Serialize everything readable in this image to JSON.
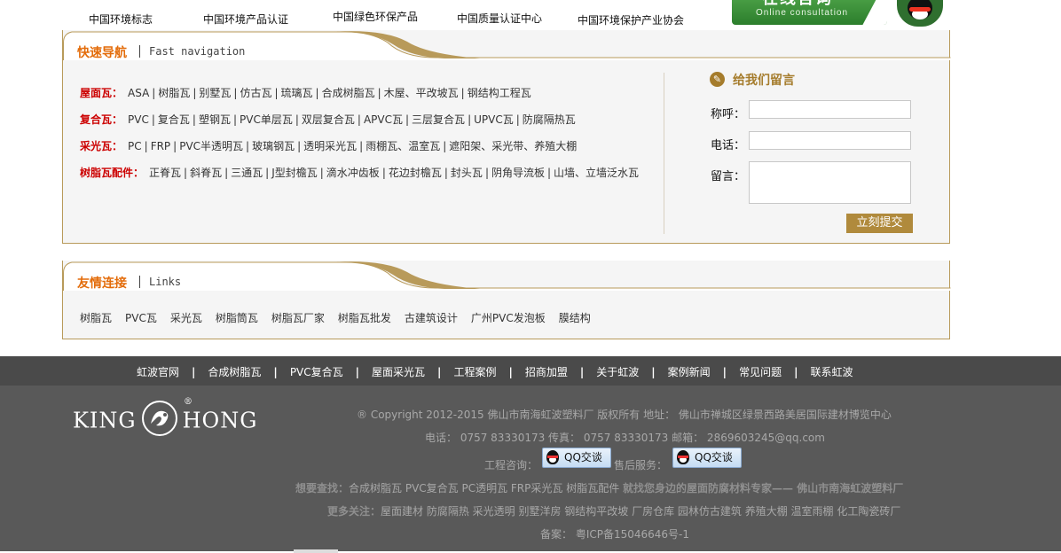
{
  "top_links": [
    "中国环境标志",
    "中国环境产品认证",
    "中国绿色环保产品",
    "中国质量认证中心",
    "中国环境保护产业协会"
  ],
  "online_consult": {
    "title": "在线咨询",
    "subtitle": "Online consultation"
  },
  "quick_nav": {
    "title": "快速导航",
    "title_en": "Fast navigation",
    "rows": [
      {
        "category": "屋面瓦：",
        "items": [
          "ASA",
          "树脂瓦",
          "别墅瓦",
          "仿古瓦",
          "琉璃瓦",
          "合成树脂瓦",
          "木屋、平改坡瓦",
          "钢结构工程瓦"
        ]
      },
      {
        "category": "复合瓦：",
        "items": [
          "PVC",
          "复合瓦",
          "塑钢瓦",
          "PVC单层瓦",
          "双层复合瓦",
          "APVC瓦",
          "三层复合瓦",
          "UPVC瓦",
          "防腐隔热瓦"
        ]
      },
      {
        "category": "采光瓦：",
        "items": [
          "PC",
          "FRP",
          "PVC半透明瓦",
          "玻璃钢瓦",
          "透明采光瓦",
          "雨棚瓦、温室瓦",
          "遮阳架、采光带、养殖大棚"
        ]
      },
      {
        "category": "树脂瓦配件：",
        "items": [
          "正脊瓦",
          "斜脊瓦",
          "三通瓦",
          "J型封檐瓦",
          "滴水冲齿板",
          "花边封檐瓦",
          "封头瓦",
          "阴角导流板",
          "山墙、立墙泛水瓦"
        ]
      }
    ]
  },
  "message": {
    "title": "给我们留言",
    "name_label": "称呼：",
    "phone_label": "电话：",
    "msg_label": "留言：",
    "name_value": "",
    "phone_value": "",
    "msg_value": "",
    "submit_label": "立刻提交"
  },
  "links": {
    "title": "友情连接",
    "title_en": "Links",
    "items": [
      "树脂瓦",
      "PVC瓦",
      "采光瓦",
      "树脂筒瓦",
      "树脂瓦厂家",
      "树脂瓦批发",
      "古建筑设计",
      "广州PVC发泡板",
      "膜结构"
    ]
  },
  "footer": {
    "nav": [
      "虹波官网",
      "合成树脂瓦",
      "PVC复合瓦",
      "屋面采光瓦",
      "工程案例",
      "招商加盟",
      "关于虹波",
      "案例新闻",
      "常见问题",
      "联系虹波"
    ],
    "logo_left": "KING",
    "logo_right": "HONG",
    "logo_reg": "®",
    "copyright": "® Copyright 2012-2015 佛山市南海虹波塑料厂 版权所有 地址：  佛山市禅城区绿景西路美居国际建材博览中心",
    "contact": "电话：  0757 83330173 传真：  0757 83330173 邮箱：   2869603245@qq.com",
    "consult_label": "工程咨询：",
    "aftersale_label": "售后服务：",
    "qq_label": "QQ交谈",
    "search_label": "想要查找：",
    "search_text": "合成树脂瓦 PVC复合瓦 PC透明瓦 FRP采光瓦 树脂瓦配件",
    "search_slogan": "就找您身边的屋面防腐材料专家—— 佛山市南海虹波塑料厂",
    "more_label": "更多关注：",
    "more_text": "屋面建材 防腐隔热 采光透明 别墅洋房 钢结构平改坡 厂房仓库 园林仿古建筑 养殖大棚 温室雨棚 化工陶瓷砖厂",
    "icp": "备案：  粤ICP备15046646号-1"
  }
}
